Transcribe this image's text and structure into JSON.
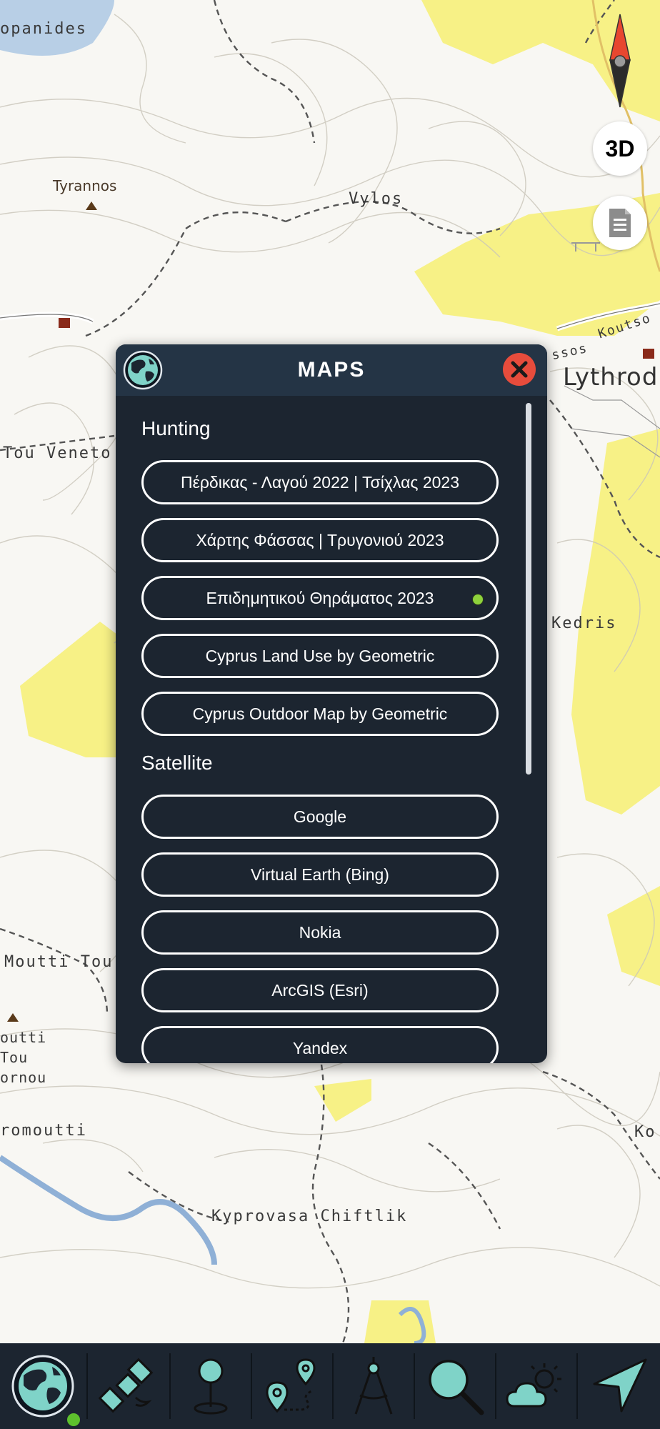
{
  "map": {
    "places": [
      "opanides",
      "Tyrannos",
      "Vylos",
      "Lythrod",
      "Tou Veneto",
      "Kedris",
      "Moutti Tou",
      "outti",
      "Tou",
      "ornou",
      "romoutti",
      "Ko",
      "Kyprovasa Chiftlik",
      "Koutso",
      "ssos"
    ]
  },
  "controls": {
    "compass_icon": "compass-icon",
    "three_d_label": "3D",
    "layers_icon": "document-icon"
  },
  "dialog": {
    "title": "MAPS",
    "globe_icon": "globe-icon",
    "close_icon": "close-icon",
    "sections": [
      {
        "title": "Hunting",
        "options": [
          {
            "label": "Πέρδικας - Λαγού 2022 | Τσίχλας 2023",
            "selected": false
          },
          {
            "label": "Χάρτης Φάσσας | Τρυγονιού 2023",
            "selected": false
          },
          {
            "label": "Επιδημητικού Θηράματος 2023",
            "selected": true
          },
          {
            "label": "Cyprus Land Use by Geometric",
            "selected": false
          },
          {
            "label": "Cyprus Outdoor Map by Geometric",
            "selected": false
          }
        ]
      },
      {
        "title": "Satellite",
        "options": [
          {
            "label": "Google",
            "selected": false
          },
          {
            "label": "Virtual Earth (Bing)",
            "selected": false
          },
          {
            "label": "Nokia",
            "selected": false
          },
          {
            "label": "ArcGIS (Esri)",
            "selected": false
          },
          {
            "label": "Yandex",
            "selected": false
          }
        ]
      }
    ],
    "selected_color": "#8ed23c"
  },
  "toolbar": {
    "tabs": [
      "globe-icon",
      "satellite-icon",
      "pin-icon",
      "route-icon",
      "compass-divider-icon",
      "search-icon",
      "weather-icon",
      "navigate-icon"
    ],
    "active_index": 0,
    "active_color": "#5ec12d"
  }
}
